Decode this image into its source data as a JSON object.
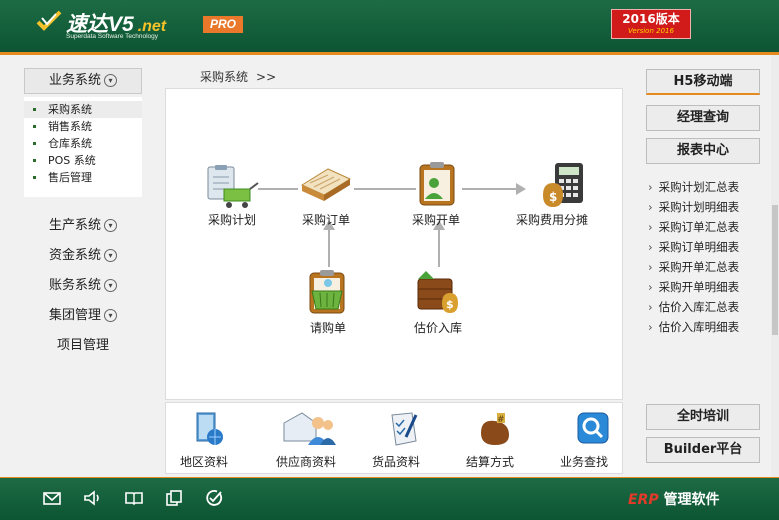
{
  "header": {
    "logo_name": "速达V5",
    "logo_suffix": ".net",
    "logo_tagline": "Superdata Software Technology",
    "pro_badge": "PRO",
    "version_title": "2016版本",
    "version_sub": "Version 2016"
  },
  "left_nav": {
    "business": "业务系统",
    "submenu": [
      "采购系统",
      "销售系统",
      "仓库系统",
      "POS 系统",
      "售后管理"
    ],
    "production": "生产系统",
    "finance": "资金系统",
    "accounting": "账务系统",
    "group": "集团管理",
    "project": "项目管理"
  },
  "breadcrumb": {
    "current": "采购系统",
    "sep": ">>"
  },
  "flow": {
    "plan": "采购计划",
    "order": "采购订单",
    "invoice": "采购开单",
    "expense": "采购费用分摊",
    "request": "请购单",
    "estimate": "估价入库"
  },
  "bottom_tools": [
    "地区资料",
    "供应商资料",
    "货品资料",
    "结算方式",
    "业务查找"
  ],
  "right_nav": {
    "h5": "H5移动端",
    "manager": "经理查询",
    "reports": "报表中心",
    "report_items": [
      "采购计划汇总表",
      "采购计划明细表",
      "采购订单汇总表",
      "采购订单明细表",
      "采购开单汇总表",
      "采购开单明细表",
      "估价入库汇总表",
      "估价入库明细表"
    ],
    "training": "全时培训",
    "builder": "Builder平台"
  },
  "footer": {
    "erp": "ERP",
    "erp_text": "管理软件"
  },
  "colors": {
    "brand_green": "#12603b",
    "accent_orange": "#e48a1e",
    "version_red": "#d11a1a"
  }
}
